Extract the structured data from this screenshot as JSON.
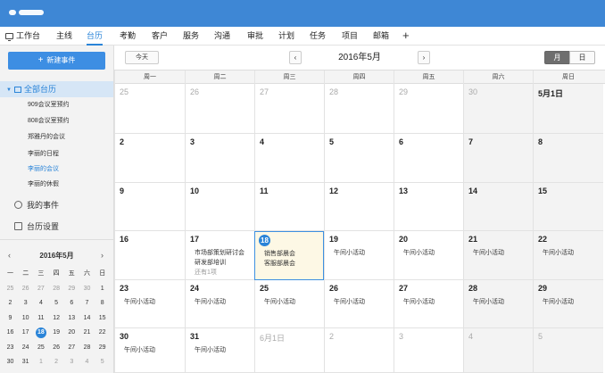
{
  "nav": {
    "items": [
      {
        "label": "工作台"
      },
      {
        "label": "主线"
      },
      {
        "label": "台历"
      },
      {
        "label": "考勤"
      },
      {
        "label": "客户"
      },
      {
        "label": "服务"
      },
      {
        "label": "沟通"
      },
      {
        "label": "审批"
      },
      {
        "label": "计划"
      },
      {
        "label": "任务"
      },
      {
        "label": "项目"
      },
      {
        "label": "邮箱"
      }
    ],
    "add": "+"
  },
  "sidebar": {
    "new_event": "新建事件",
    "all_calendars": "全部台历",
    "calendars": [
      "909会议室预约",
      "808会议室预约",
      "郑雅丹的会议",
      "李丽的日程",
      "李丽的会议",
      "李丽的休假"
    ],
    "my_events": "我的事件",
    "calendar_settings": "台历设置"
  },
  "mini_calendar": {
    "title": "2016年5月",
    "prev": "‹",
    "next": "›",
    "weekdays": [
      "一",
      "二",
      "三",
      "四",
      "五",
      "六",
      "日"
    ],
    "rows": [
      [
        "25",
        "26",
        "27",
        "28",
        "29",
        "30",
        "1"
      ],
      [
        "2",
        "3",
        "4",
        "5",
        "6",
        "7",
        "8"
      ],
      [
        "9",
        "10",
        "11",
        "12",
        "13",
        "14",
        "15"
      ],
      [
        "16",
        "17",
        "18",
        "19",
        "20",
        "21",
        "22"
      ],
      [
        "23",
        "24",
        "25",
        "26",
        "27",
        "28",
        "29"
      ],
      [
        "30",
        "31",
        "1",
        "2",
        "3",
        "4",
        "5"
      ]
    ]
  },
  "toolbar": {
    "today": "今天",
    "prev": "‹",
    "next": "›",
    "title": "2016年5月",
    "month_view": "月",
    "day_view": "日"
  },
  "calendar": {
    "weekdays": [
      "周一",
      "周二",
      "周三",
      "周四",
      "周五",
      "周六",
      "周日"
    ],
    "weeks": [
      [
        {
          "d": "25",
          "dim": true
        },
        {
          "d": "26",
          "dim": true
        },
        {
          "d": "27",
          "dim": true
        },
        {
          "d": "28",
          "dim": true
        },
        {
          "d": "29",
          "dim": true
        },
        {
          "d": "30",
          "dim": true
        },
        {
          "d": "5月1日"
        }
      ],
      [
        {
          "d": "2"
        },
        {
          "d": "3"
        },
        {
          "d": "4"
        },
        {
          "d": "5"
        },
        {
          "d": "6"
        },
        {
          "d": "7"
        },
        {
          "d": "8"
        }
      ],
      [
        {
          "d": "9"
        },
        {
          "d": "10"
        },
        {
          "d": "11"
        },
        {
          "d": "12"
        },
        {
          "d": "13"
        },
        {
          "d": "14"
        },
        {
          "d": "15"
        }
      ],
      [
        {
          "d": "16"
        },
        {
          "d": "17",
          "events": [
            "市场部策划研讨会",
            "研发部培训"
          ],
          "more": "还有1项"
        },
        {
          "d": "18",
          "today": true,
          "events": [
            "销售部晨会",
            "客服部晨会"
          ]
        },
        {
          "d": "19",
          "events": [
            "午间小活动"
          ]
        },
        {
          "d": "20",
          "events": [
            "午间小活动"
          ]
        },
        {
          "d": "21",
          "events": [
            "午间小活动"
          ]
        },
        {
          "d": "22",
          "events": [
            "午间小活动"
          ]
        }
      ],
      [
        {
          "d": "23",
          "events": [
            "午间小活动"
          ]
        },
        {
          "d": "24",
          "events": [
            "午间小活动"
          ]
        },
        {
          "d": "25",
          "events": [
            "午间小活动"
          ]
        },
        {
          "d": "26",
          "events": [
            "午间小活动"
          ]
        },
        {
          "d": "27",
          "events": [
            "午间小活动"
          ]
        },
        {
          "d": "28",
          "events": [
            "午间小活动"
          ]
        },
        {
          "d": "29",
          "events": [
            "午间小活动"
          ]
        }
      ],
      [
        {
          "d": "30",
          "events": [
            "午间小活动"
          ]
        },
        {
          "d": "31",
          "events": [
            "午间小活动"
          ]
        },
        {
          "d": "6月1日",
          "dim": true
        },
        {
          "d": "2",
          "dim": true
        },
        {
          "d": "3",
          "dim": true
        },
        {
          "d": "4",
          "dim": true
        },
        {
          "d": "5",
          "dim": true
        }
      ]
    ]
  },
  "colors": {
    "brand": "#3e87d5",
    "accent": "#2a84d8",
    "today_bg": "#fdf8e5"
  }
}
